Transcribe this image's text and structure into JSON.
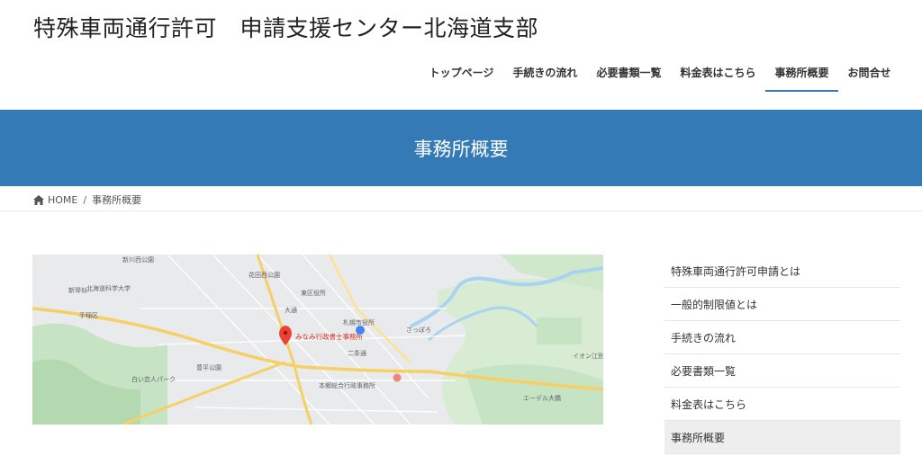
{
  "header": {
    "site_title": "特殊車両通行許可　申請支援センター北海道支部",
    "nav": [
      {
        "label": "トップページ"
      },
      {
        "label": "手続きの流れ"
      },
      {
        "label": "必要書類一覧"
      },
      {
        "label": "料金表はこちら"
      },
      {
        "label": "事務所概要",
        "active": true
      },
      {
        "label": "お問合せ"
      }
    ]
  },
  "page_header": {
    "title": "事務所概要"
  },
  "breadcrumb": {
    "home_icon": "home-icon",
    "home_label": "HOME",
    "separator": "/",
    "current": "事務所概要"
  },
  "map": {
    "marker_label": "みなみ行政書士事務所",
    "places": [
      "新川西公園",
      "北海道科学大学",
      "花田西公園",
      "札幌市役所",
      "東区役所",
      "本郷総合行政事務所",
      "豊平公園",
      "白い恋人パーク",
      "手稲区",
      "新琴似",
      "大通",
      "さっぽろ",
      "二条通",
      "エーデル大橋",
      "イオン江別"
    ],
    "accent_color": "#ea4335"
  },
  "sidebar": {
    "items": [
      {
        "label": "特殊車両通行許可申請とは"
      },
      {
        "label": "一般的制限値とは"
      },
      {
        "label": "手続きの流れ"
      },
      {
        "label": "必要書類一覧"
      },
      {
        "label": "料金表はこちら"
      },
      {
        "label": "事務所概要",
        "active": true
      }
    ]
  },
  "colors": {
    "brand": "#337ab7",
    "nav_underline": "#337ab7",
    "active_bg": "#eeeeee"
  }
}
